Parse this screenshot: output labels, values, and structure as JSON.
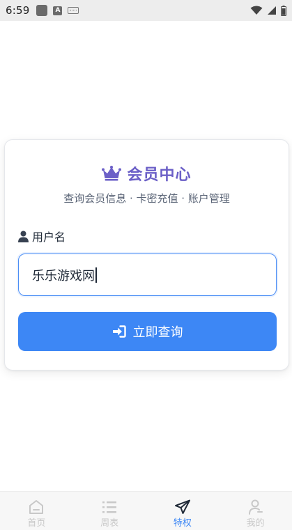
{
  "status_bar": {
    "time": "6:59",
    "left_icons": [
      "notification-square-icon",
      "text-a-icon",
      "keyboard-icon"
    ],
    "right_icons": [
      "wifi-icon",
      "signal-icon",
      "battery-icon"
    ]
  },
  "card": {
    "title": "会员中心",
    "title_icon": "crown-icon",
    "subtitle": "查询会员信息 · 卡密充值 · 账户管理",
    "field_label": "用户名",
    "field_icon": "user-icon",
    "input_value": "乐乐游戏网",
    "submit_label": "立即查询",
    "submit_icon": "login-arrow-icon"
  },
  "bottom_nav": {
    "items": [
      {
        "label": "首页",
        "icon": "home-icon",
        "active": false
      },
      {
        "label": "周表",
        "icon": "list-icon",
        "active": false
      },
      {
        "label": "特权",
        "icon": "paper-plane-icon",
        "active": true
      },
      {
        "label": "我的",
        "icon": "profile-icon",
        "active": false
      }
    ]
  },
  "colors": {
    "accent": "#3d87f5",
    "title": "#6b5fc7",
    "status_bar_bg": "#ededed",
    "nav_inactive": "#c8c8c8"
  }
}
